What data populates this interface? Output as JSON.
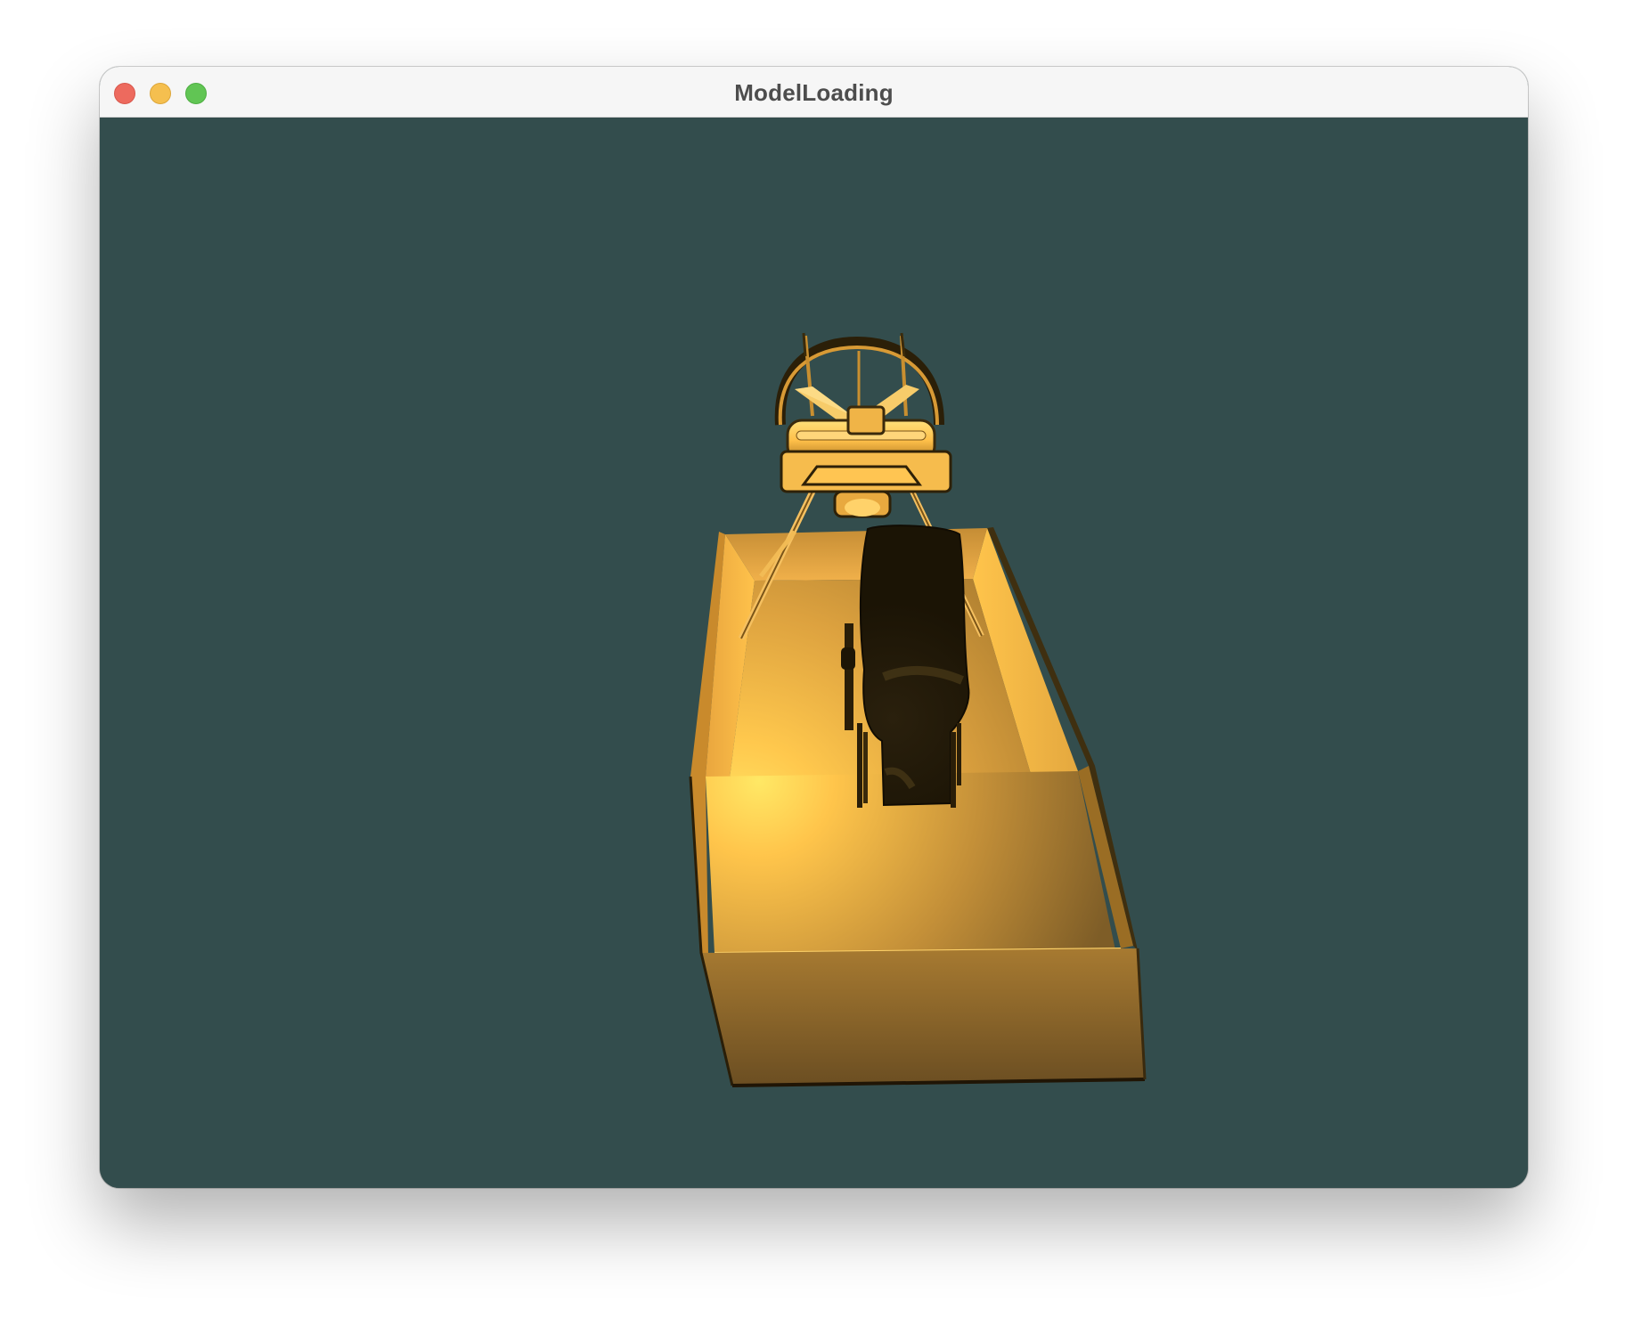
{
  "window": {
    "title": "ModelLoading"
  },
  "viewport": {
    "clear_color": "#334d4d",
    "model_color": "#ffbe46"
  }
}
